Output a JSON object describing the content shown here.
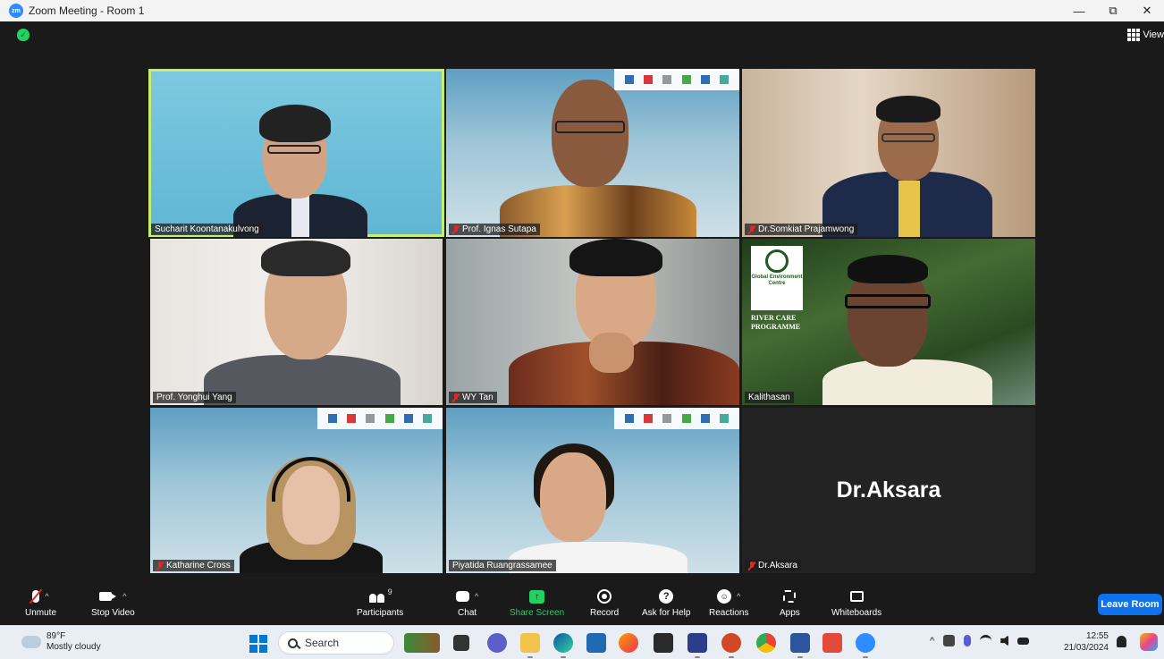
{
  "window": {
    "app_logo_text": "zm",
    "title": "Zoom Meeting - Room 1",
    "minimize": "—",
    "restore": "⧉",
    "close": "✕"
  },
  "topbar": {
    "view_label": "View"
  },
  "participants_tiles": [
    {
      "name": "Sucharit Koontanakulvong",
      "muted": false,
      "active_speaker": true
    },
    {
      "name": "Prof. Ignas Sutapa",
      "muted": true
    },
    {
      "name": "Dr.Somkiat Prajamwong",
      "muted": true
    },
    {
      "name": "Prof. Yonghui Yang",
      "muted": false
    },
    {
      "name": "WY Tan",
      "muted": true
    },
    {
      "name": "Kalithasan",
      "muted": false
    },
    {
      "name": "Katharine Cross",
      "muted": true
    },
    {
      "name": "Piyatida Ruangrassamee",
      "muted": false
    },
    {
      "name": "Dr.Aksara",
      "muted": true,
      "video_off": true,
      "center_name": "Dr.Aksara"
    }
  ],
  "background_texts": {
    "gec_logo": "Global Environment Centre",
    "river_care": "RIVER CARE PROGRAMME"
  },
  "toolbar": {
    "unmute": "Unmute",
    "stop_video": "Stop Video",
    "participants": "Participants",
    "participants_count": "9",
    "chat": "Chat",
    "share_screen": "Share Screen",
    "record": "Record",
    "ask_for_help": "Ask for Help",
    "reactions": "Reactions",
    "apps": "Apps",
    "whiteboards": "Whiteboards",
    "leave_room": "Leave Room",
    "caret": "^"
  },
  "taskbar": {
    "weather_temp": "89°F",
    "weather_desc": "Mostly cloudy",
    "search_label": "Search",
    "tray_caret": "^",
    "time": "12:55",
    "date": "21/03/2024"
  },
  "colors": {
    "accent": "#0e72ed",
    "green": "#23d160",
    "active_speaker": "#c9ef6a",
    "mute_red": "#e02828"
  }
}
